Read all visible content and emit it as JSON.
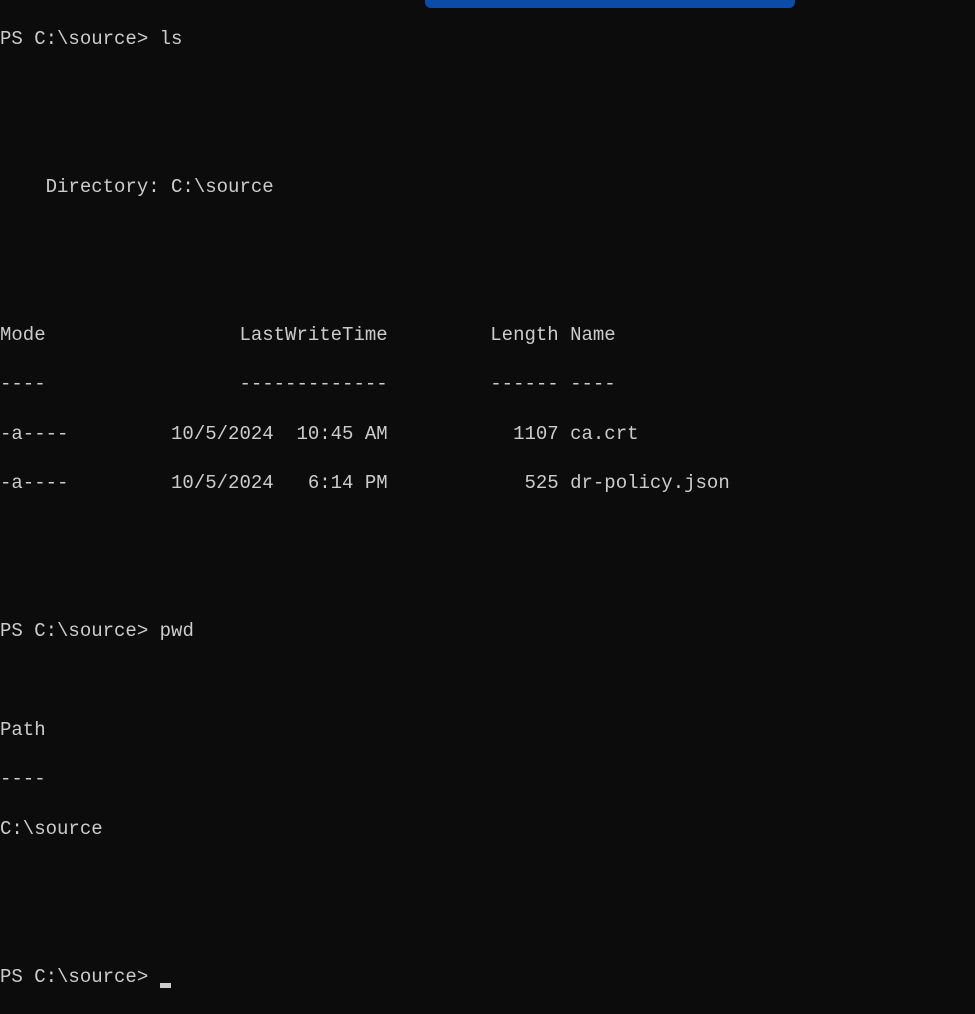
{
  "prompt1": {
    "prefix": "PS C:\\source> ",
    "command": "ls"
  },
  "directory_header": "    Directory: C:\\source",
  "table_header": "Mode                 LastWriteTime         Length Name",
  "table_divider": "----                 -------------         ------ ----",
  "files": [
    "-a----         10/5/2024  10:45 AM           1107 ca.crt",
    "-a----         10/5/2024   6:14 PM            525 dr-policy.json"
  ],
  "prompt2": {
    "prefix": "PS C:\\source> ",
    "command": "pwd"
  },
  "path_header": "Path",
  "path_divider": "----",
  "path_value": "C:\\source",
  "prompt3": {
    "prefix": "PS C:\\source> "
  }
}
